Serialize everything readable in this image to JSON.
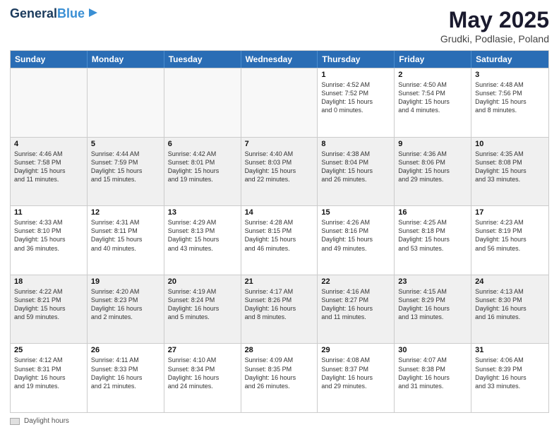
{
  "logo": {
    "line1": "General",
    "line2": "Blue"
  },
  "title": "May 2025",
  "subtitle": "Grudki, Podlasie, Poland",
  "days": [
    "Sunday",
    "Monday",
    "Tuesday",
    "Wednesday",
    "Thursday",
    "Friday",
    "Saturday"
  ],
  "footer_label": "Daylight hours",
  "rows": [
    [
      {
        "day": "",
        "content": ""
      },
      {
        "day": "",
        "content": ""
      },
      {
        "day": "",
        "content": ""
      },
      {
        "day": "",
        "content": ""
      },
      {
        "day": "1",
        "content": "Sunrise: 4:52 AM\nSunset: 7:52 PM\nDaylight: 15 hours\nand 0 minutes."
      },
      {
        "day": "2",
        "content": "Sunrise: 4:50 AM\nSunset: 7:54 PM\nDaylight: 15 hours\nand 4 minutes."
      },
      {
        "day": "3",
        "content": "Sunrise: 4:48 AM\nSunset: 7:56 PM\nDaylight: 15 hours\nand 8 minutes."
      }
    ],
    [
      {
        "day": "4",
        "content": "Sunrise: 4:46 AM\nSunset: 7:58 PM\nDaylight: 15 hours\nand 11 minutes."
      },
      {
        "day": "5",
        "content": "Sunrise: 4:44 AM\nSunset: 7:59 PM\nDaylight: 15 hours\nand 15 minutes."
      },
      {
        "day": "6",
        "content": "Sunrise: 4:42 AM\nSunset: 8:01 PM\nDaylight: 15 hours\nand 19 minutes."
      },
      {
        "day": "7",
        "content": "Sunrise: 4:40 AM\nSunset: 8:03 PM\nDaylight: 15 hours\nand 22 minutes."
      },
      {
        "day": "8",
        "content": "Sunrise: 4:38 AM\nSunset: 8:04 PM\nDaylight: 15 hours\nand 26 minutes."
      },
      {
        "day": "9",
        "content": "Sunrise: 4:36 AM\nSunset: 8:06 PM\nDaylight: 15 hours\nand 29 minutes."
      },
      {
        "day": "10",
        "content": "Sunrise: 4:35 AM\nSunset: 8:08 PM\nDaylight: 15 hours\nand 33 minutes."
      }
    ],
    [
      {
        "day": "11",
        "content": "Sunrise: 4:33 AM\nSunset: 8:10 PM\nDaylight: 15 hours\nand 36 minutes."
      },
      {
        "day": "12",
        "content": "Sunrise: 4:31 AM\nSunset: 8:11 PM\nDaylight: 15 hours\nand 40 minutes."
      },
      {
        "day": "13",
        "content": "Sunrise: 4:29 AM\nSunset: 8:13 PM\nDaylight: 15 hours\nand 43 minutes."
      },
      {
        "day": "14",
        "content": "Sunrise: 4:28 AM\nSunset: 8:15 PM\nDaylight: 15 hours\nand 46 minutes."
      },
      {
        "day": "15",
        "content": "Sunrise: 4:26 AM\nSunset: 8:16 PM\nDaylight: 15 hours\nand 49 minutes."
      },
      {
        "day": "16",
        "content": "Sunrise: 4:25 AM\nSunset: 8:18 PM\nDaylight: 15 hours\nand 53 minutes."
      },
      {
        "day": "17",
        "content": "Sunrise: 4:23 AM\nSunset: 8:19 PM\nDaylight: 15 hours\nand 56 minutes."
      }
    ],
    [
      {
        "day": "18",
        "content": "Sunrise: 4:22 AM\nSunset: 8:21 PM\nDaylight: 15 hours\nand 59 minutes."
      },
      {
        "day": "19",
        "content": "Sunrise: 4:20 AM\nSunset: 8:23 PM\nDaylight: 16 hours\nand 2 minutes."
      },
      {
        "day": "20",
        "content": "Sunrise: 4:19 AM\nSunset: 8:24 PM\nDaylight: 16 hours\nand 5 minutes."
      },
      {
        "day": "21",
        "content": "Sunrise: 4:17 AM\nSunset: 8:26 PM\nDaylight: 16 hours\nand 8 minutes."
      },
      {
        "day": "22",
        "content": "Sunrise: 4:16 AM\nSunset: 8:27 PM\nDaylight: 16 hours\nand 11 minutes."
      },
      {
        "day": "23",
        "content": "Sunrise: 4:15 AM\nSunset: 8:29 PM\nDaylight: 16 hours\nand 13 minutes."
      },
      {
        "day": "24",
        "content": "Sunrise: 4:13 AM\nSunset: 8:30 PM\nDaylight: 16 hours\nand 16 minutes."
      }
    ],
    [
      {
        "day": "25",
        "content": "Sunrise: 4:12 AM\nSunset: 8:31 PM\nDaylight: 16 hours\nand 19 minutes."
      },
      {
        "day": "26",
        "content": "Sunrise: 4:11 AM\nSunset: 8:33 PM\nDaylight: 16 hours\nand 21 minutes."
      },
      {
        "day": "27",
        "content": "Sunrise: 4:10 AM\nSunset: 8:34 PM\nDaylight: 16 hours\nand 24 minutes."
      },
      {
        "day": "28",
        "content": "Sunrise: 4:09 AM\nSunset: 8:35 PM\nDaylight: 16 hours\nand 26 minutes."
      },
      {
        "day": "29",
        "content": "Sunrise: 4:08 AM\nSunset: 8:37 PM\nDaylight: 16 hours\nand 29 minutes."
      },
      {
        "day": "30",
        "content": "Sunrise: 4:07 AM\nSunset: 8:38 PM\nDaylight: 16 hours\nand 31 minutes."
      },
      {
        "day": "31",
        "content": "Sunrise: 4:06 AM\nSunset: 8:39 PM\nDaylight: 16 hours\nand 33 minutes."
      }
    ]
  ]
}
